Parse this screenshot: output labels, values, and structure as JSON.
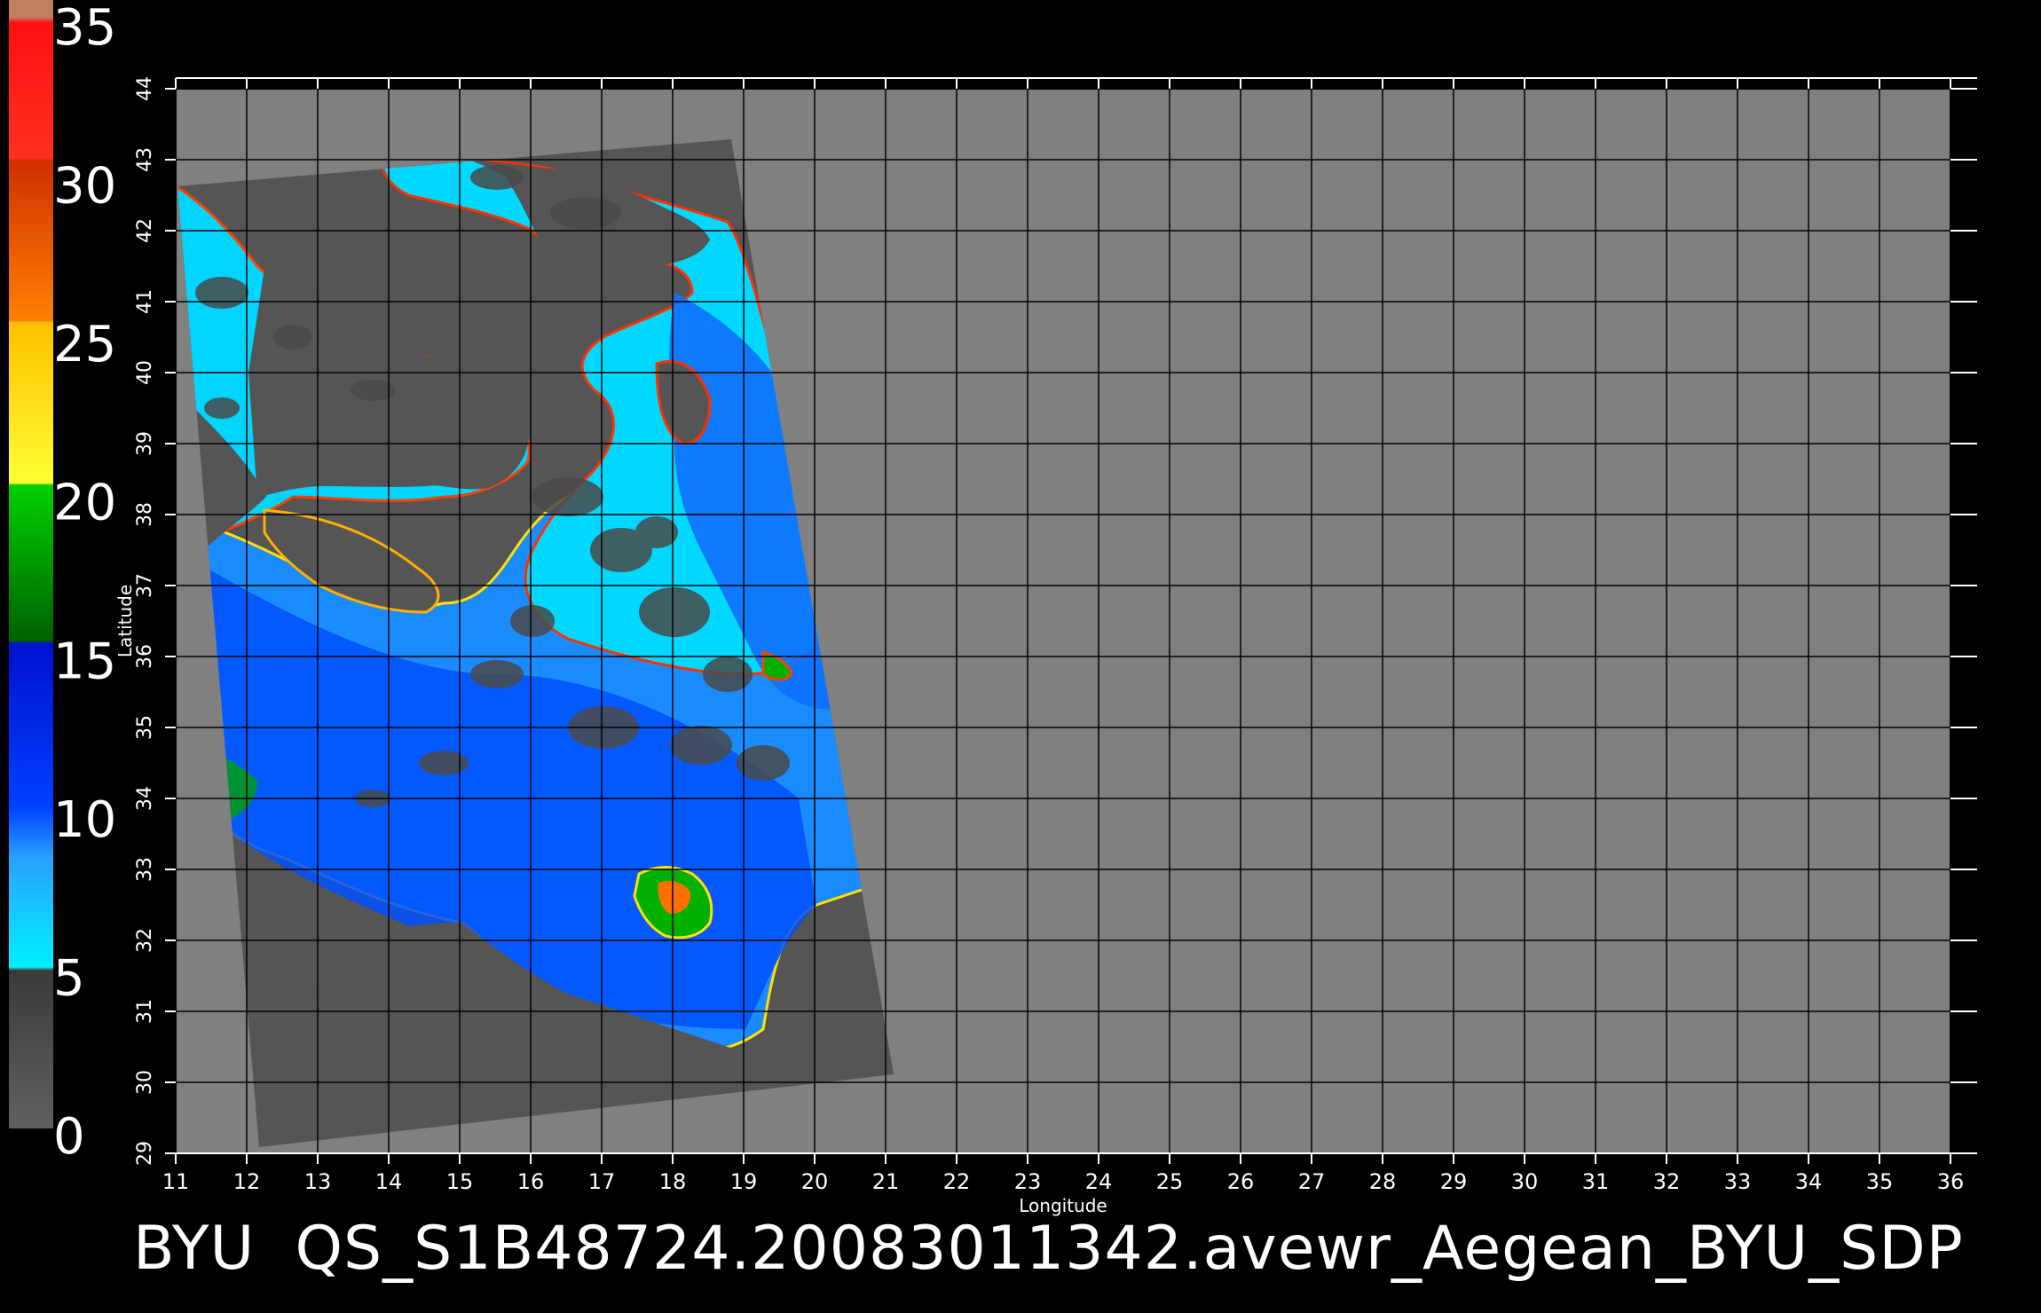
{
  "title": "BYU  QS_S1B48724.20083011342.avewr_Aegean_BYU_SDP",
  "map": {
    "xlabel": "Longitude",
    "ylabel": "Latitude",
    "lon_ticks": [
      "11",
      "12",
      "13",
      "14",
      "15",
      "16",
      "17",
      "18",
      "19",
      "20",
      "21",
      "22",
      "23",
      "24",
      "25",
      "26",
      "27",
      "28",
      "29",
      "30",
      "31",
      "32",
      "33",
      "34",
      "35",
      "36"
    ],
    "lat_ticks": [
      "29",
      "30",
      "31",
      "32",
      "33",
      "34",
      "35",
      "36",
      "37",
      "38",
      "39",
      "40",
      "41",
      "42",
      "43",
      "44"
    ],
    "lon_range": [
      11,
      36
    ],
    "lat_range": [
      29,
      44
    ],
    "grid": true,
    "background_color": "#808080",
    "swath_color": "#555555",
    "land_color": "#505050"
  },
  "colorbar": {
    "ticks": [
      "0",
      "5",
      "10",
      "15",
      "20",
      "25",
      "30",
      "35"
    ],
    "range": [
      0,
      35
    ],
    "colors": [
      "#606060",
      "#00e5ff",
      "#0060ff",
      "#00a000",
      "#ffd000",
      "#ff6000",
      "#ff2010",
      "#c08060"
    ]
  }
}
